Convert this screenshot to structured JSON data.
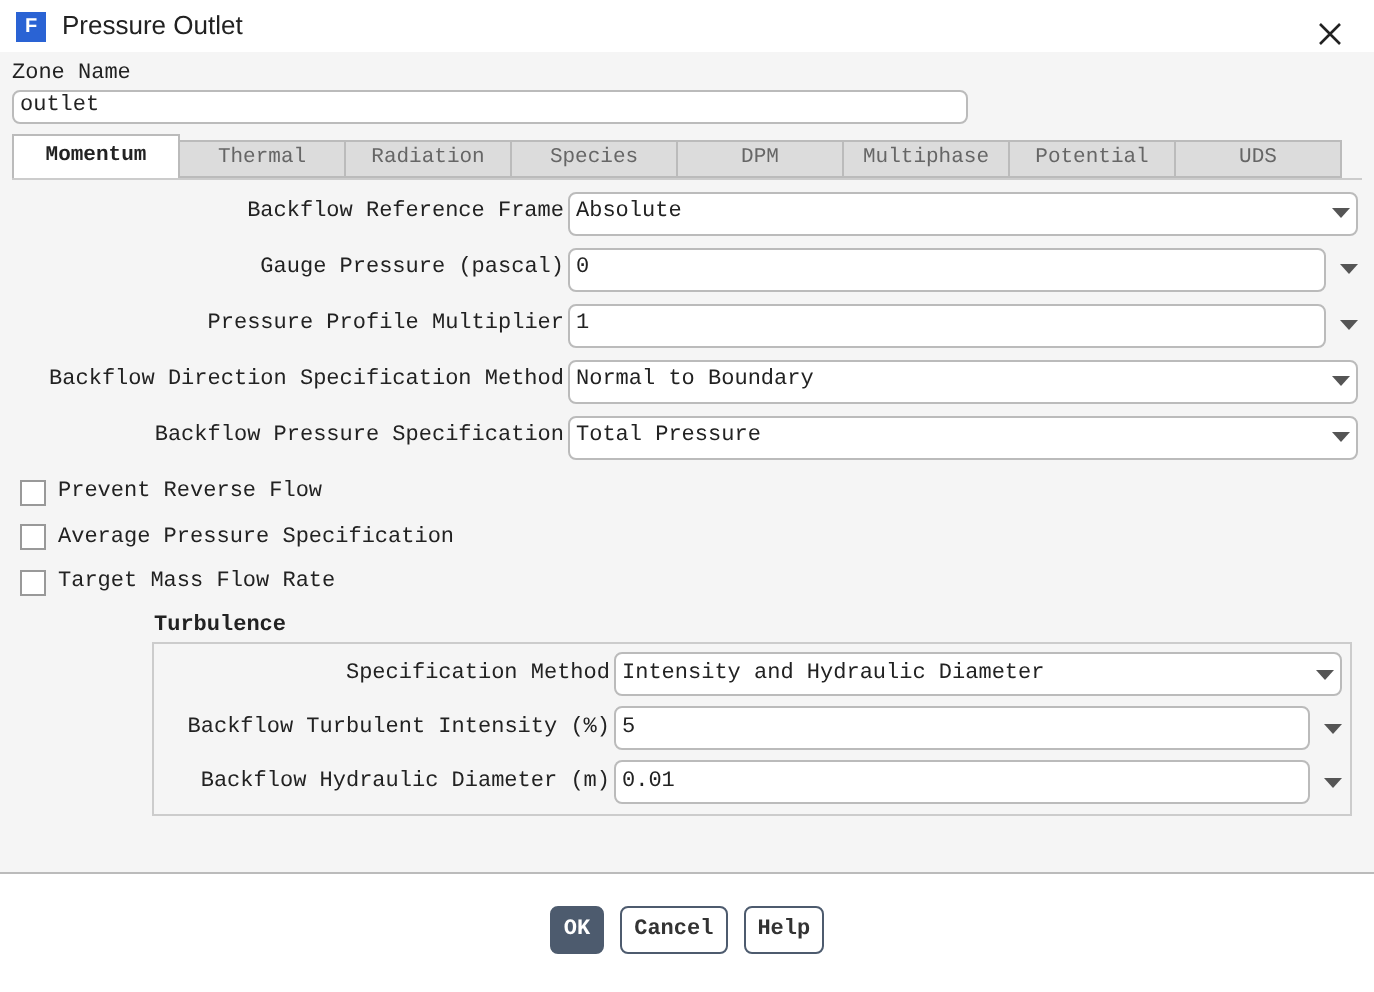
{
  "window": {
    "title": "Pressure Outlet",
    "icon_letter": "F"
  },
  "zone_name": {
    "label": "Zone Name",
    "value": "outlet"
  },
  "tabs": [
    {
      "label": "Momentum",
      "selected": true
    },
    {
      "label": "Thermal",
      "selected": false
    },
    {
      "label": "Radiation",
      "selected": false
    },
    {
      "label": "Species",
      "selected": false
    },
    {
      "label": "DPM",
      "selected": false
    },
    {
      "label": "Multiphase",
      "selected": false
    },
    {
      "label": "Potential",
      "selected": false
    },
    {
      "label": "UDS",
      "selected": false
    }
  ],
  "fields": [
    {
      "label": "Backflow Reference Frame",
      "kind": "dropdown",
      "value": "Absolute"
    },
    {
      "label": "Gauge Pressure (pascal)",
      "kind": "input",
      "value": "0"
    },
    {
      "label": "Pressure Profile Multiplier",
      "kind": "input",
      "value": "1"
    },
    {
      "label": "Backflow Direction Specification Method",
      "kind": "dropdown",
      "value": "Normal to Boundary"
    },
    {
      "label": "Backflow Pressure Specification",
      "kind": "dropdown",
      "value": "Total Pressure"
    }
  ],
  "checkboxes": [
    {
      "label": "Prevent Reverse Flow",
      "checked": false
    },
    {
      "label": "Average Pressure Specification",
      "checked": false
    },
    {
      "label": "Target Mass Flow Rate",
      "checked": false
    }
  ],
  "turbulence": {
    "title": "Turbulence",
    "fields": [
      {
        "label": "Specification Method",
        "kind": "dropdown",
        "value": "Intensity and Hydraulic Diameter"
      },
      {
        "label": "Backflow Turbulent Intensity (%)",
        "kind": "input",
        "value": "5"
      },
      {
        "label": "Backflow Hydraulic Diameter (m)",
        "kind": "input",
        "value": "0.01"
      }
    ]
  },
  "buttons": [
    {
      "label": "OK",
      "primary": true
    },
    {
      "label": "Cancel",
      "primary": false
    },
    {
      "label": "Help",
      "primary": false
    }
  ]
}
